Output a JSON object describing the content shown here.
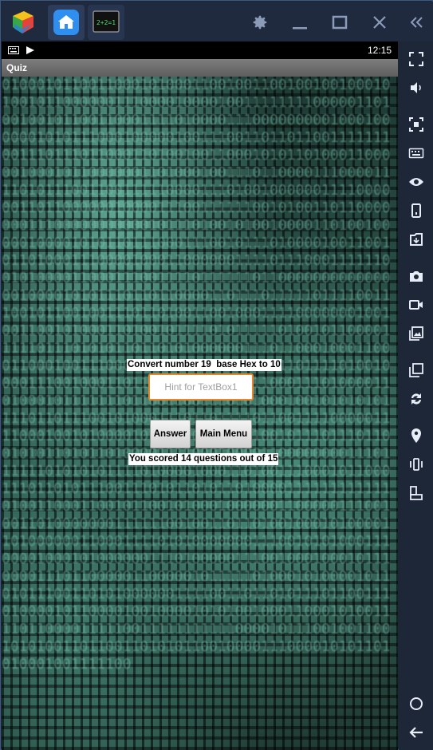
{
  "emulator": {
    "tabs": [
      {
        "name": "bluestacks-logo-icon"
      },
      {
        "name": "home-icon"
      },
      {
        "name": "math-game-app-icon",
        "label": "2+2=1"
      }
    ],
    "title_buttons": [
      "gear-icon",
      "minimize-icon",
      "maximize-icon",
      "close-icon",
      "collapse-icon"
    ],
    "sidebar_icons": [
      "fullscreen-icon",
      "volume-icon",
      "screen-lock-icon",
      "keyboard-icon",
      "eye-icon",
      "phone-icon",
      "apk-install-icon",
      "camera-icon",
      "video-record-icon",
      "media-icon",
      "multi-instance-icon",
      "rotate-icon",
      "location-icon",
      "shake-icon",
      "resize-icon",
      "home-circle-icon",
      "back-icon"
    ]
  },
  "status_bar": {
    "time": "12:15"
  },
  "app": {
    "title": "Quiz",
    "question": "Convert number 19  base Hex to 10",
    "input_placeholder": "Hint for TextBox1",
    "input_value": "",
    "answer_button": "Answer",
    "menu_button": "Main Menu",
    "score_text": "You scored 14 questions out of 15"
  },
  "colors": {
    "input_border": "#e8862d",
    "emulator_bg": "#1e2738",
    "icon": "#8b9bb8",
    "sidebar_icon": "#e8eef8"
  }
}
